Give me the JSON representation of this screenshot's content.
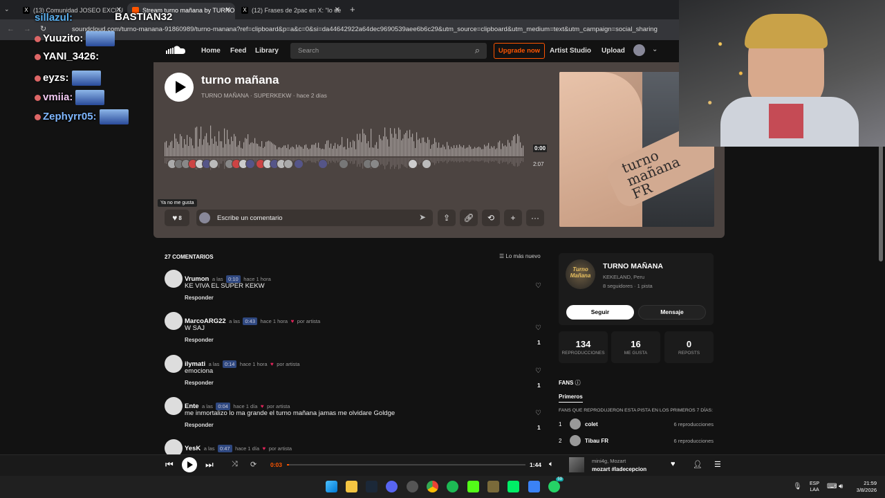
{
  "browser": {
    "tabs": [
      {
        "label": "(13) Comunidad JOSEO EXCLU"
      },
      {
        "label": "Stream turno mañana by TURNO"
      },
      {
        "label": "(12) Frases de 2pac en X: \"lo de"
      }
    ],
    "url": "soundcloud.com/turno-manana-91860989/turno-manana?ref=clipboard&p=a&c=0&si=da44642922a64dec9690539aee6b6c29&utm_source=clipboard&utm_medium=text&utm_campaign=social_sharing"
  },
  "chat": {
    "top_user": "BASTIAN32",
    "messages": [
      {
        "user": "sillazul:"
      },
      {
        "user": "Yuuzito:"
      },
      {
        "user": "YANI_3426:"
      },
      {
        "user": "eyzs:"
      },
      {
        "user": "vmiia:"
      },
      {
        "user": "Zephyrr05:"
      }
    ]
  },
  "soundcloud": {
    "nav": {
      "home": "Home",
      "feed": "Feed",
      "library": "Library",
      "search_placeholder": "Search",
      "upgrade": "Upgrade now",
      "artist_studio": "Artist Studio",
      "upload": "Upload"
    },
    "track": {
      "title": "turno mañana",
      "artist": "TURNO MAÑANA",
      "group": "SUPERKEKW",
      "age": "hace 2 días",
      "time_current": "0:00",
      "duration": "2:07",
      "art_tattoo": "turno mañana FR",
      "tooltip": "Ya no me gusta",
      "likes_partial": "8",
      "comment_placeholder": "Escribe un comentario"
    },
    "comments_header": {
      "count": "27 COMENTARIOS",
      "sort": "Lo más nuevo"
    },
    "comments": [
      {
        "user": "Vrumon",
        "at": "a las",
        "time": "0:10",
        "age": "hace 1 hora",
        "by_artist": "",
        "text": "KE VIVA EL SUPER KEKW",
        "reply": "Responder",
        "likes": ""
      },
      {
        "user": "MarcoARG22",
        "at": "a las",
        "time": "0:43",
        "age": "hace 1 hora",
        "by_artist": "por artista",
        "text": "W SAJ",
        "reply": "Responder",
        "likes": "1"
      },
      {
        "user": "ilymati",
        "at": "a las",
        "time": "0:14",
        "age": "hace 1 hora",
        "by_artist": "por artista",
        "text": "emociona",
        "reply": "Responder",
        "likes": "1"
      },
      {
        "user": "Ente",
        "at": "a las",
        "time": "0:04",
        "age": "hace 1 día",
        "by_artist": "por artista",
        "text": "me inmortalizo lo ma grande el turno mañana jamas me olvidare Goldge",
        "reply": "Responder",
        "likes": "1"
      },
      {
        "user": "YesK",
        "at": "a las",
        "time": "0:47",
        "age": "hace 1 día",
        "by_artist": "por artista",
        "text": "",
        "reply": "",
        "likes": ""
      }
    ],
    "artist_panel": {
      "name": "TURNO MAÑANA",
      "logo_text": "Turno Mañana",
      "location": "KEKELAND, Peru",
      "followers": "8 seguidores",
      "tracks": "1 pista",
      "follow": "Seguir",
      "message": "Mensaje",
      "stats": [
        {
          "value": "134",
          "label": "REPRODUCCIONES"
        },
        {
          "value": "16",
          "label": "ME GUSTA"
        },
        {
          "value": "0",
          "label": "REPOSTS"
        }
      ],
      "fans_title": "FANS",
      "fans_tab": "Primeros",
      "fans_desc": "FANS QUE REPRODUJERON ESTA PISTA EN LOS PRIMEROS 7 DÍAS:",
      "fans": [
        {
          "rank": "1",
          "name": "colet",
          "plays": "6 reproducciones"
        },
        {
          "rank": "2",
          "name": "Tibau FR",
          "plays": "6 reproducciones"
        }
      ]
    },
    "player": {
      "current": "0:03",
      "total": "1:44",
      "progress": 0.01,
      "artist": "mini4g, Mozart",
      "title": "mozart #ladecepcion"
    }
  },
  "taskbar": {
    "lang1": "ESP",
    "lang2": "LAA",
    "time": "21:59",
    "date": "3/8/2026",
    "badge": "59"
  }
}
